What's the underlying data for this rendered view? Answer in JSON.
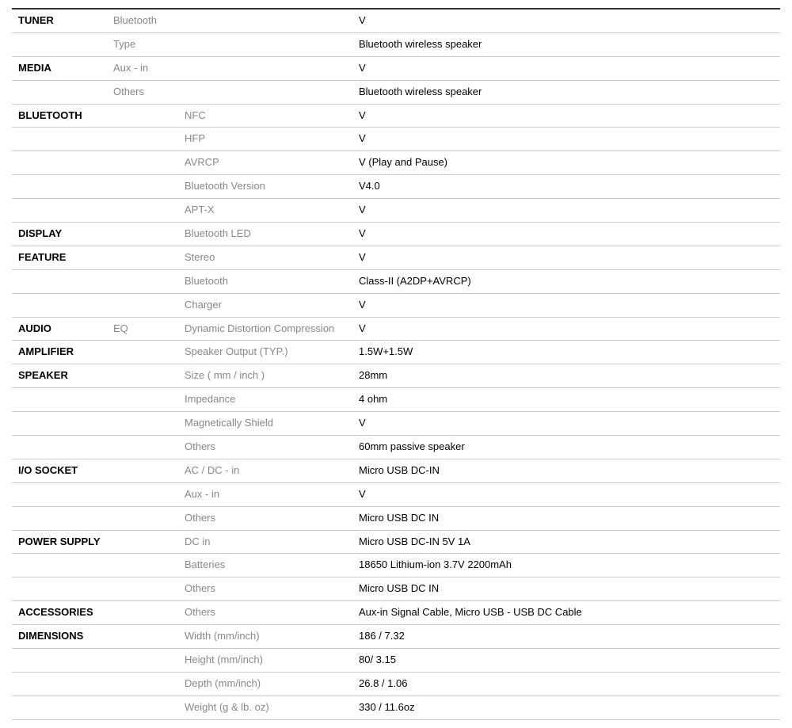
{
  "rows": [
    {
      "cat": "TUNER",
      "sub": "Bluetooth",
      "spec": "",
      "val": "V"
    },
    {
      "cat": "",
      "sub": "Type",
      "spec": "",
      "val": "Bluetooth wireless speaker"
    },
    {
      "cat": "MEDIA",
      "sub": "Aux - in",
      "spec": "",
      "val": "V"
    },
    {
      "cat": "",
      "sub": "Others",
      "spec": "",
      "val": "Bluetooth wireless speaker"
    },
    {
      "cat": "BLUETOOTH",
      "sub": "",
      "spec": "NFC",
      "val": "V"
    },
    {
      "cat": "",
      "sub": "",
      "spec": "HFP",
      "val": "V"
    },
    {
      "cat": "",
      "sub": "",
      "spec": "AVRCP",
      "val": "V (Play and Pause)"
    },
    {
      "cat": "",
      "sub": "",
      "spec": "Bluetooth Version",
      "val": "V4.0"
    },
    {
      "cat": "",
      "sub": "",
      "spec": "APT-X",
      "val": "V"
    },
    {
      "cat": "DISPLAY",
      "sub": "",
      "spec": "Bluetooth LED",
      "val": "V"
    },
    {
      "cat": "FEATURE",
      "sub": "",
      "spec": "Stereo",
      "val": "V"
    },
    {
      "cat": "",
      "sub": "",
      "spec": "Bluetooth",
      "val": "Class-II (A2DP+AVRCP)"
    },
    {
      "cat": "",
      "sub": "",
      "spec": "Charger",
      "val": "V"
    },
    {
      "cat": "AUDIO",
      "sub": "EQ",
      "spec": "Dynamic Distortion Compression",
      "val": "V"
    },
    {
      "cat": "AMPLIFIER",
      "sub": "",
      "spec": "Speaker Output (TYP.)",
      "val": "1.5W+1.5W"
    },
    {
      "cat": "SPEAKER",
      "sub": "",
      "spec": "Size ( mm / inch )",
      "val": "28mm"
    },
    {
      "cat": "",
      "sub": "",
      "spec": "Impedance",
      "val": "4 ohm"
    },
    {
      "cat": "",
      "sub": "",
      "spec": "Magnetically Shield",
      "val": "V"
    },
    {
      "cat": "",
      "sub": "",
      "spec": "Others",
      "val": "60mm passive speaker"
    },
    {
      "cat": "I/O SOCKET",
      "sub": "",
      "spec": "AC / DC - in",
      "val": "Micro USB DC-IN"
    },
    {
      "cat": "",
      "sub": "",
      "spec": "Aux - in",
      "val": "V"
    },
    {
      "cat": "",
      "sub": "",
      "spec": "Others",
      "val": "Micro USB DC IN"
    },
    {
      "cat": "POWER SUPPLY",
      "sub": "",
      "spec": "DC in",
      "val": "Micro USB DC-IN 5V 1A"
    },
    {
      "cat": "",
      "sub": "",
      "spec": "Batteries",
      "val": "18650 Lithium-ion 3.7V 2200mAh"
    },
    {
      "cat": "",
      "sub": "",
      "spec": "Others",
      "val": "Micro USB DC IN"
    },
    {
      "cat": "ACCESSORIES",
      "sub": "",
      "spec": "Others",
      "val": "Aux-in Signal Cable, Micro USB - USB DC Cable"
    },
    {
      "cat": "DIMENSIONS",
      "sub": "",
      "spec": "Width (mm/inch)",
      "val": "186 / 7.32"
    },
    {
      "cat": "",
      "sub": "",
      "spec": "Height (mm/inch)",
      "val": "80/ 3.15"
    },
    {
      "cat": "",
      "sub": "",
      "spec": "Depth (mm/inch)",
      "val": "26.8 / 1.06"
    },
    {
      "cat": "",
      "sub": "",
      "spec": "Weight (g & lb. oz)",
      "val": "330 / 11.6oz"
    }
  ]
}
